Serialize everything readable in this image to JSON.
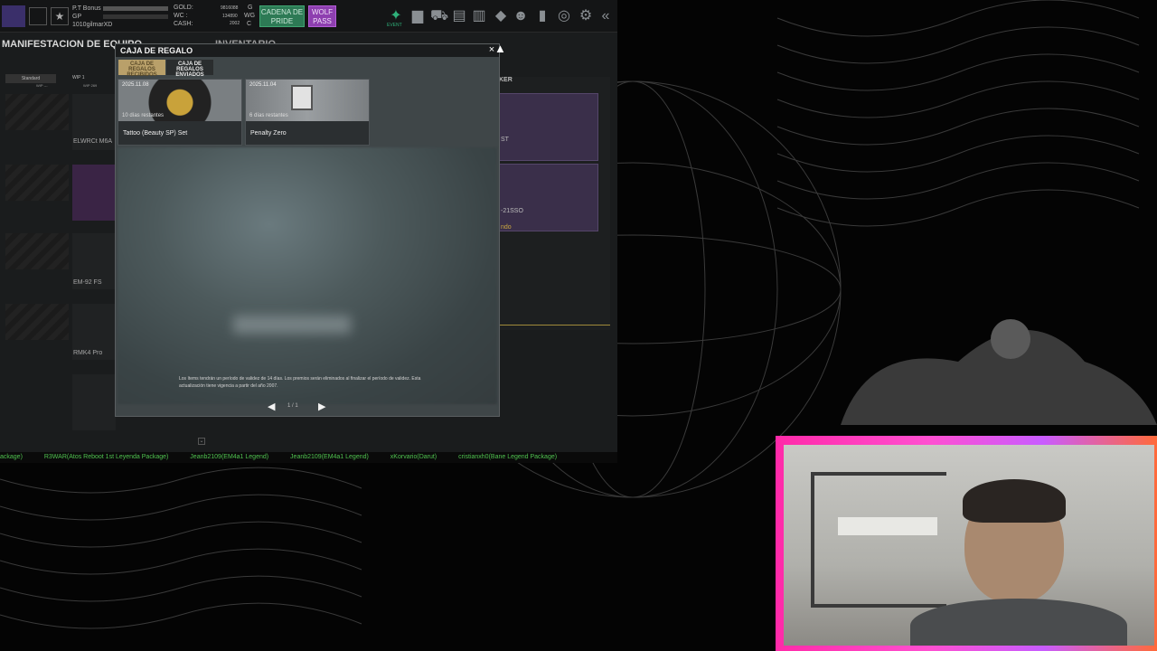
{
  "topbar": {
    "pt_bonus": "P.T Bonus",
    "gp": "GP",
    "player_name": "1010gilmarXD",
    "gold_label": "GOLD:",
    "wc_label": "WC :",
    "cash_label": "CASH:",
    "gold_value": "9816088",
    "wc_value": "134890",
    "cash_value": "2002",
    "gold_unit": "G",
    "wc_unit": "WG",
    "cash_unit": "C",
    "cadena_button": "CADENA DE PRIDE",
    "wolf_button": "WOLF PASS",
    "event_label": "EVENT"
  },
  "screen": {
    "equip_title": "MANIFESTACION DE EQUIPO",
    "inventory_title": "INVENTARIO",
    "tab_standard": "Standard",
    "tab_wip": "WIP 1",
    "wip_sub1": "WIP ---",
    "wip_sub2": "WIP 269",
    "locker_tab": "KER",
    "weapons": [
      "ELWRCt M6A",
      "EM-92 FS",
      "RMK4 Pro"
    ],
    "right_labels": [
      "ST",
      "-21SSO",
      "ndo"
    ]
  },
  "ticker": [
    "ackage)",
    "R3WAR(Atos Reboot 1st Leyenda Package)",
    "Jeanb2109(EM4a1 Legend)",
    "Jeanb2109(EM4a1 Legend)",
    "xKorvario(Darut)",
    "cristianxh0(Bane Legend Package)"
  ],
  "dialog": {
    "title": "CAJA DE REGALO",
    "close": "×",
    "tab_received": "CAJA DE REGALOS RECIBIDOS",
    "tab_sent": "CAJA DE REGALOS ENVIADOS",
    "gifts": [
      {
        "date": "2025.11.08",
        "days": "10 días restantes",
        "name": "Tattoo (Beauty SP) Set"
      },
      {
        "date": "2025.11.04",
        "days": "6 días restantes",
        "name": "Penalty Zero"
      }
    ],
    "notice": "Los ítems tendrán un período de validez de 14 días. Los premios serán eliminados al finalizar el período de validez. Esta actualización tiene vigencia a partir del año 2007.",
    "page": "1 / 1",
    "prev": "◀",
    "next": "▶"
  },
  "colors": {
    "cam_frame": "#ff2aa8",
    "ticker": "#4fc24f",
    "cadena": "#2d7a55",
    "wolf": "#8e3fb0"
  }
}
